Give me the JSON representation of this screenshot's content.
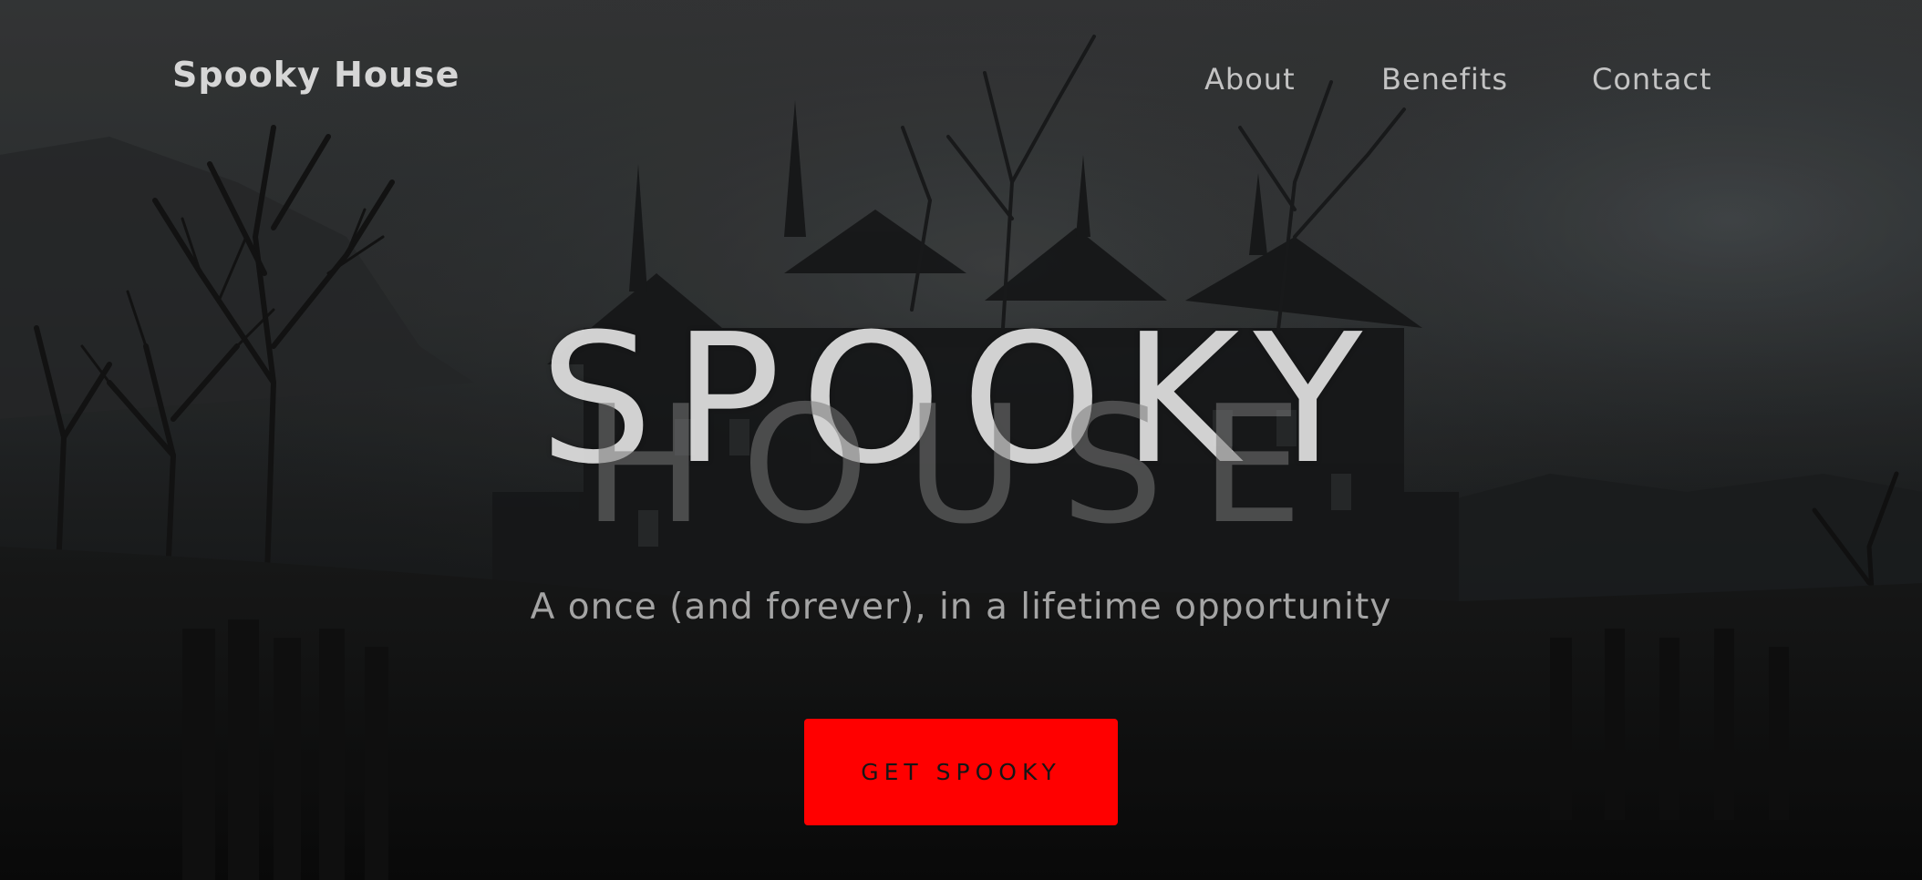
{
  "nav": {
    "brand": "Spooky House",
    "links": [
      {
        "label": "About"
      },
      {
        "label": "Benefits"
      },
      {
        "label": "Contact"
      }
    ]
  },
  "hero": {
    "title_line1": "SPOOKY",
    "title_line2": "HOUSE",
    "tagline": "A once (and forever), in a lifetime opportunity",
    "cta_label": "GET SPOOKY"
  },
  "colors": {
    "accent": "#ff0000",
    "background": "#1a1b1c",
    "nav_text": "#c3c3c3"
  },
  "background_image": "dark haunted mansion among bare trees under cloudy sky"
}
